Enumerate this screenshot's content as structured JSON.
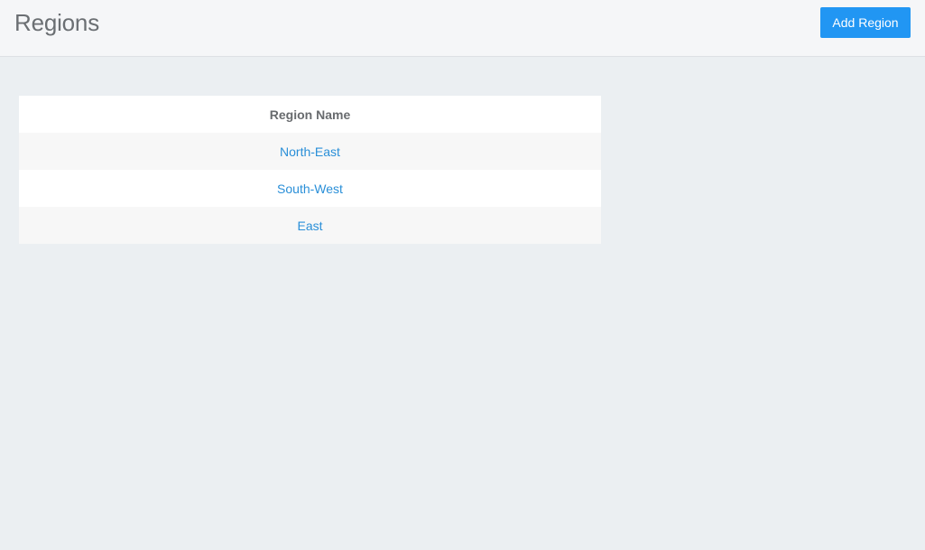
{
  "header": {
    "title": "Regions",
    "add_button_label": "Add Region"
  },
  "table": {
    "columns": [
      "Region Name"
    ],
    "rows": [
      {
        "name": "North-East"
      },
      {
        "name": "South-West"
      },
      {
        "name": "East"
      }
    ]
  },
  "colors": {
    "accent": "#2196f3",
    "link": "#2a8fd8",
    "page_background": "#ebeff2",
    "header_background": "#f5f6f8"
  }
}
